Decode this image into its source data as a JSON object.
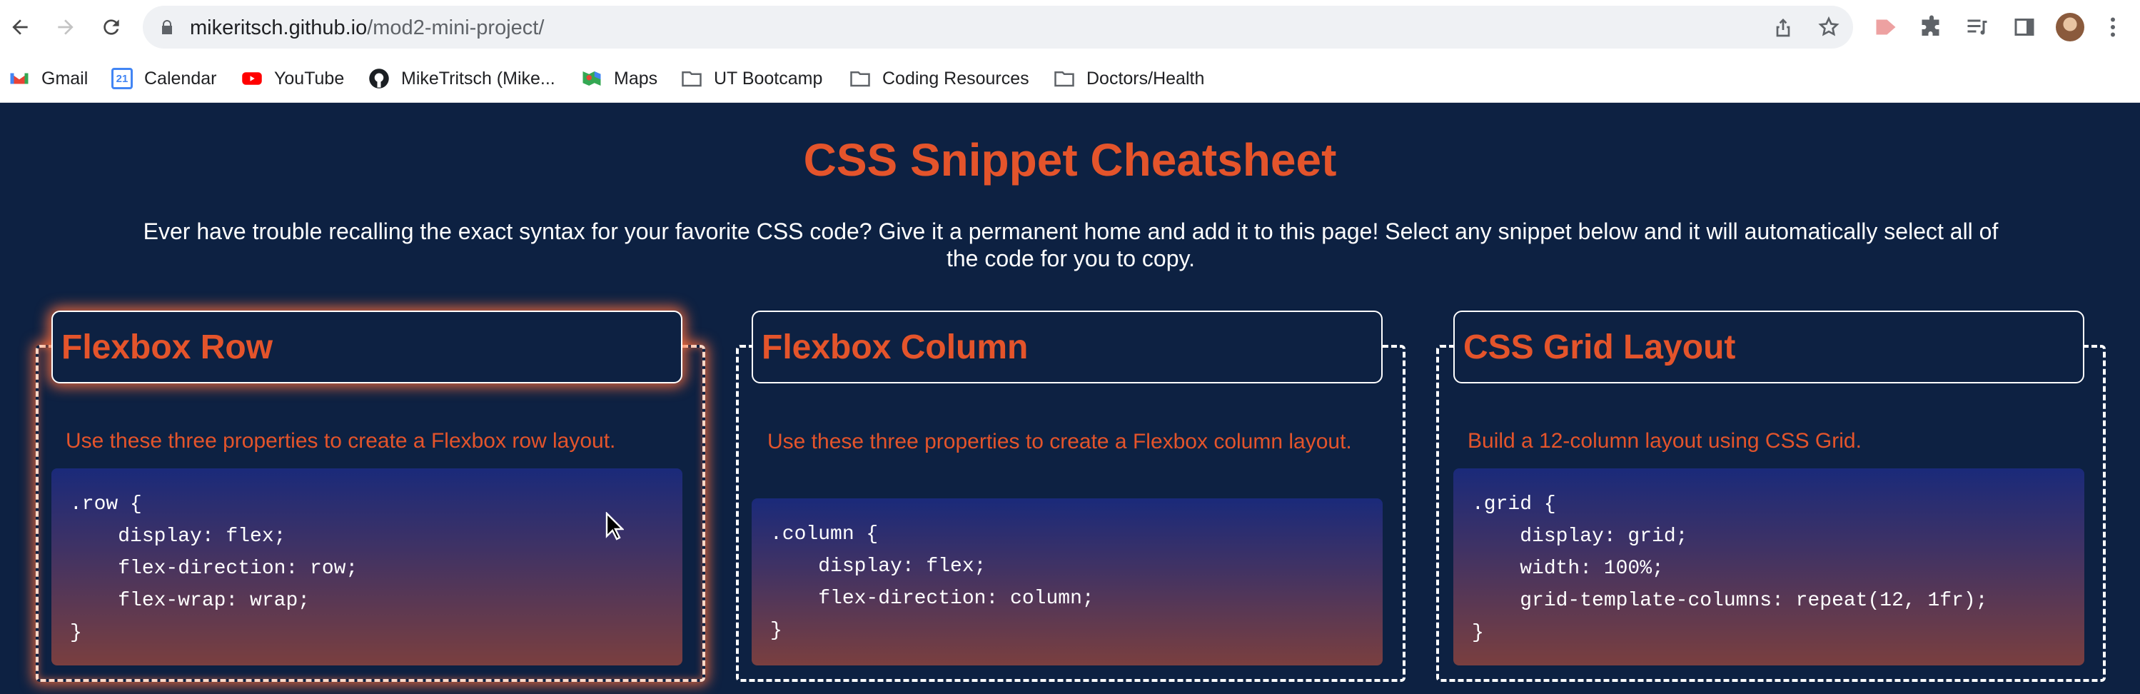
{
  "browser": {
    "url_domain": "mikeritsch.github.io",
    "url_path": "/mod2-mini-project/"
  },
  "bookmarks": [
    {
      "label": "Gmail",
      "icon": "gmail-icon"
    },
    {
      "label": "Calendar",
      "icon": "calendar-icon"
    },
    {
      "label": "YouTube",
      "icon": "youtube-icon"
    },
    {
      "label": "MikeTritsch (Mike...",
      "icon": "github-icon"
    },
    {
      "label": "Maps",
      "icon": "maps-icon"
    },
    {
      "label": "UT Bootcamp",
      "icon": "folder-icon"
    },
    {
      "label": "Coding Resources",
      "icon": "folder-icon"
    },
    {
      "label": "Doctors/Health",
      "icon": "folder-icon"
    }
  ],
  "calendar_day": "21",
  "page": {
    "title": "CSS Snippet Cheatsheet",
    "intro": "Ever have trouble recalling the exact syntax for your favorite CSS code? Give it a permanent home and add it to this page! Select any snippet below and it will automatically select all of the code for you to copy."
  },
  "cards": [
    {
      "title": "Flexbox Row",
      "description": "Use these three properties to create a Flexbox row layout.",
      "code": ".row {\n    display: flex;\n    flex-direction: row;\n    flex-wrap: wrap;\n}",
      "active": true
    },
    {
      "title": "Flexbox Column",
      "description": "Use these three properties to create a Flexbox column layout.",
      "code": ".column {\n    display: flex;\n    flex-direction: column;\n}",
      "active": false
    },
    {
      "title": "CSS Grid Layout",
      "description": "Build a 12-column layout using CSS Grid.",
      "code": ".grid {\n    display: grid;\n    width: 100%;\n    grid-template-columns: repeat(12, 1fr);\n}",
      "active": false
    }
  ],
  "colors": {
    "accent": "#e4542b",
    "page_bg": "#0d2142"
  }
}
